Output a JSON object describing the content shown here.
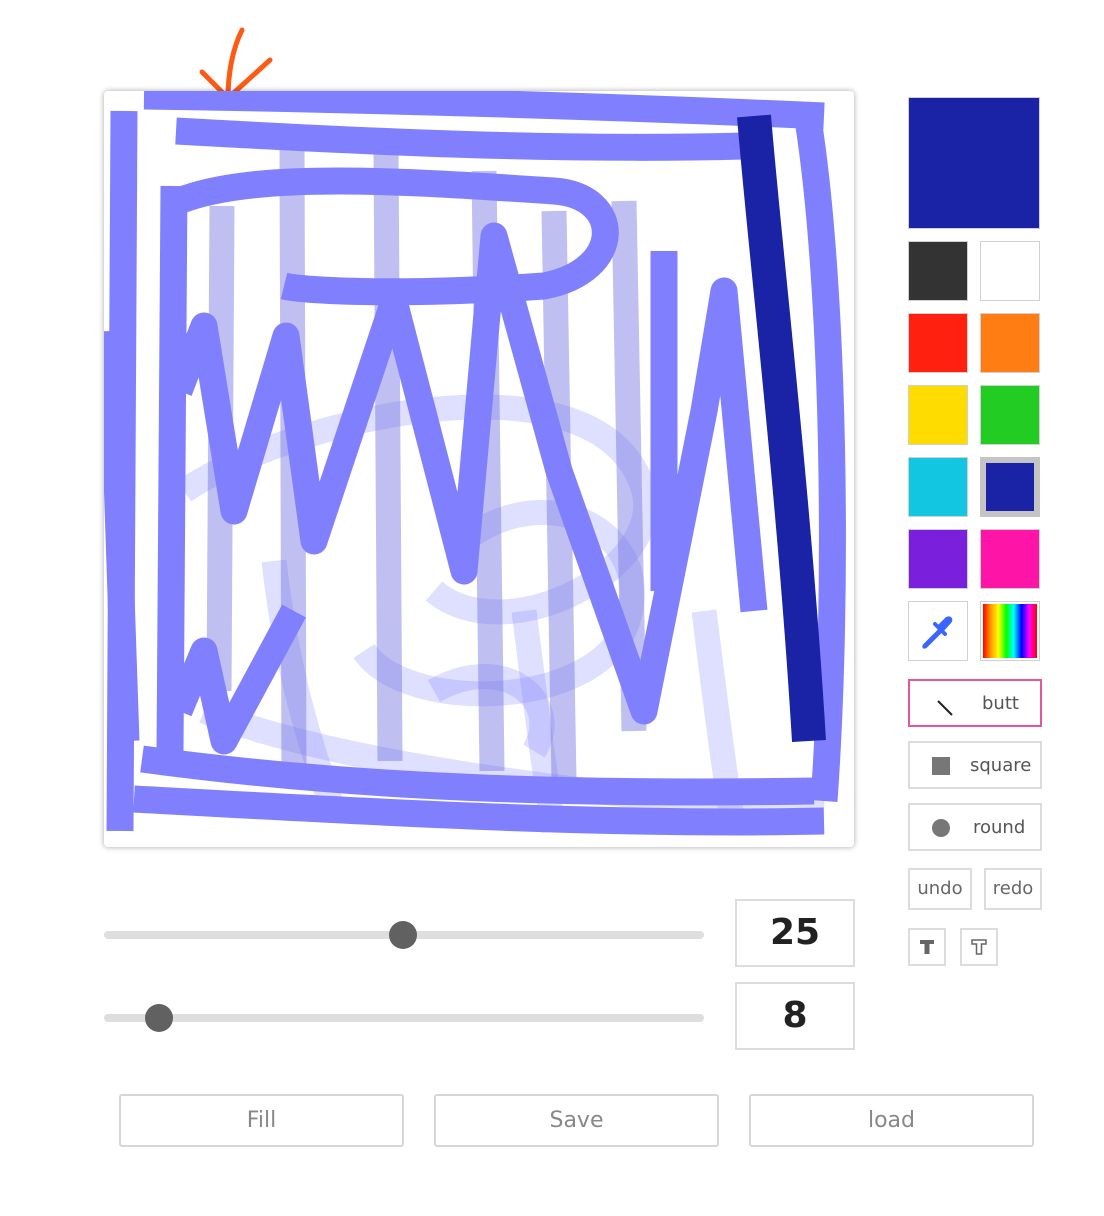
{
  "palette": {
    "current_color": "#1a22a6",
    "swatches": [
      {
        "name": "black",
        "color": "#333333"
      },
      {
        "name": "white",
        "color": "#ffffff"
      },
      {
        "name": "red",
        "color": "#ff2010"
      },
      {
        "name": "orange",
        "color": "#ff7d12"
      },
      {
        "name": "yellow",
        "color": "#ffdc00"
      },
      {
        "name": "green",
        "color": "#22cc22"
      },
      {
        "name": "cyan",
        "color": "#12c5e0"
      },
      {
        "name": "navy",
        "color": "#1a22a6"
      },
      {
        "name": "purple",
        "color": "#7a1fdc"
      },
      {
        "name": "pink",
        "color": "#ff14a8"
      }
    ],
    "selected_swatch": "navy",
    "eyedropper_icon": "eyedropper-icon",
    "rainbow_icon": "rainbow-gradient-icon"
  },
  "line_cap": {
    "options": [
      {
        "icon": "butt-cap-icon",
        "label": "butt"
      },
      {
        "icon": "square-cap-icon",
        "label": "square"
      },
      {
        "icon": "round-cap-icon",
        "label": "round"
      }
    ],
    "active": "butt"
  },
  "history": {
    "undo_label": "undo",
    "redo_label": "redo"
  },
  "text_tools": {
    "fill_text_icon": "text-filled-icon",
    "stroke_text_icon": "text-outline-icon"
  },
  "sliders": {
    "size": {
      "value": 25,
      "fraction": 0.5
    },
    "opacity": {
      "value": 8,
      "fraction": 0.08
    }
  },
  "actions": {
    "fill_label": "Fill",
    "save_label": "Save",
    "load_label": "load"
  },
  "annotation": {
    "arrow_color": "#ff5a14"
  },
  "stroke_colors": {
    "light": "#8080ff",
    "dark": "#1a22a6"
  }
}
